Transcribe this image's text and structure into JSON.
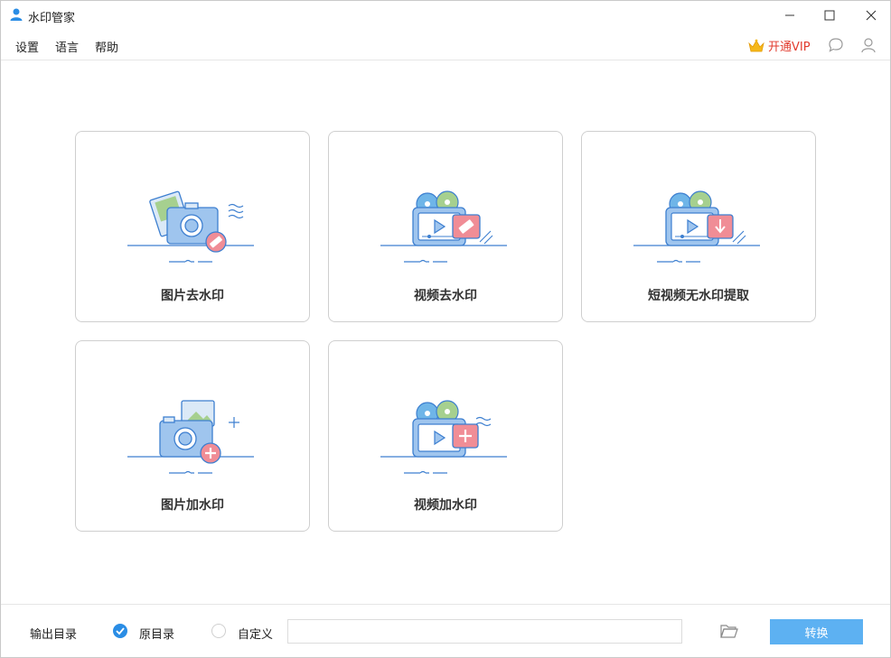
{
  "app": {
    "title": "水印管家"
  },
  "menu": {
    "settings": "设置",
    "language": "语言",
    "help": "帮助"
  },
  "vip": {
    "label": "开通VIP"
  },
  "cards": [
    {
      "label": "图片去水印"
    },
    {
      "label": "视频去水印"
    },
    {
      "label": "短视频无水印提取"
    },
    {
      "label": "图片加水印"
    },
    {
      "label": "视频加水印"
    }
  ],
  "footer": {
    "output_label": "输出目录",
    "option_original": "原目录",
    "option_custom": "自定义",
    "path_value": "",
    "convert_label": "转换"
  },
  "colors": {
    "accent": "#2a8de5",
    "vip": "#e23b2d",
    "button": "#5db1f2",
    "badge": "#f08d96"
  }
}
